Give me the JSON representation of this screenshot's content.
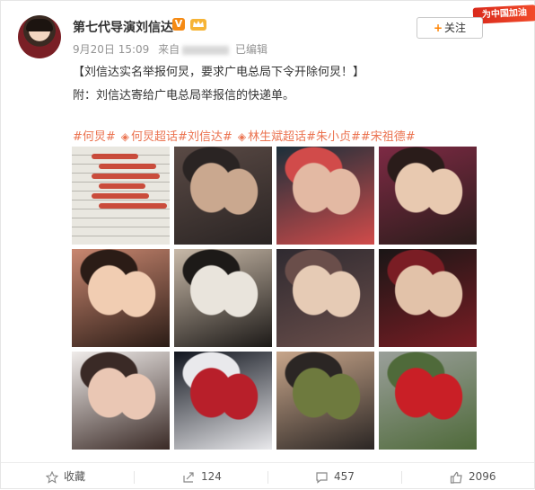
{
  "post": {
    "author": "第七代导演刘信达",
    "verified_badge": "V",
    "date": "9月20日 15:09",
    "source_prefix": "来自",
    "edited": "已编辑",
    "follow_label": "关注",
    "promo_text": "为中国加油",
    "line1": "【刘信达实名举报何炅，要求广电总局下令开除何炅！】",
    "line2": "附：刘信达寄给广电总局举报信的快递单。",
    "tags": [
      {
        "text": "#何炅#",
        "super": false
      },
      {
        "text": "何炅超话",
        "super": true
      },
      {
        "text": "#刘信达#",
        "super": false
      },
      {
        "text": "林生斌超话",
        "super": true
      },
      {
        "text": "#朱小贞#",
        "super": false
      },
      {
        "text": "#宋祖德#",
        "super": false
      }
    ]
  },
  "photos": [
    {
      "name": "photo-handwritten-document",
      "palette": [
        "#e9e7e0",
        "#c63b2a",
        "#9a9a96"
      ]
    },
    {
      "name": "photo-couple-kiss-party",
      "palette": [
        "#5a4a45",
        "#caa88f",
        "#2a2423"
      ]
    },
    {
      "name": "photo-kiss-tv",
      "palette": [
        "#1c2f3a",
        "#e3b9a3",
        "#d14b4a"
      ]
    },
    {
      "name": "photo-couple-selfie",
      "palette": [
        "#7d2a44",
        "#e8c9b0",
        "#2a1c1a"
      ]
    },
    {
      "name": "photo-man-closeup",
      "palette": [
        "#c98770",
        "#f1cdb2",
        "#2b1c16"
      ]
    },
    {
      "name": "photo-kiss-tribute",
      "palette": [
        "#c8b9a8",
        "#e9e4dc",
        "#1d1a18"
      ]
    },
    {
      "name": "photo-group-selfie",
      "palette": [
        "#2f2a30",
        "#e6cbb5",
        "#6a4e4a"
      ]
    },
    {
      "name": "photo-couple-dark",
      "palette": [
        "#1a1616",
        "#e2c2a9",
        "#7a1d24"
      ]
    },
    {
      "name": "photo-couple-white",
      "palette": [
        "#f0ecea",
        "#eac7b4",
        "#3a2a26"
      ]
    },
    {
      "name": "photo-stage-performers",
      "palette": [
        "#10141d",
        "#b81f2a",
        "#e9e9ec"
      ]
    },
    {
      "name": "photo-elder-man",
      "palette": [
        "#c7a58a",
        "#6e7a3e",
        "#2b2624"
      ]
    },
    {
      "name": "photo-street-banner",
      "palette": [
        "#9a9f9a",
        "#c91f26",
        "#4f6a3a"
      ]
    }
  ],
  "actions": {
    "favorite_label": "收藏",
    "repost_count": "124",
    "comment_count": "457",
    "like_count": "2096"
  }
}
